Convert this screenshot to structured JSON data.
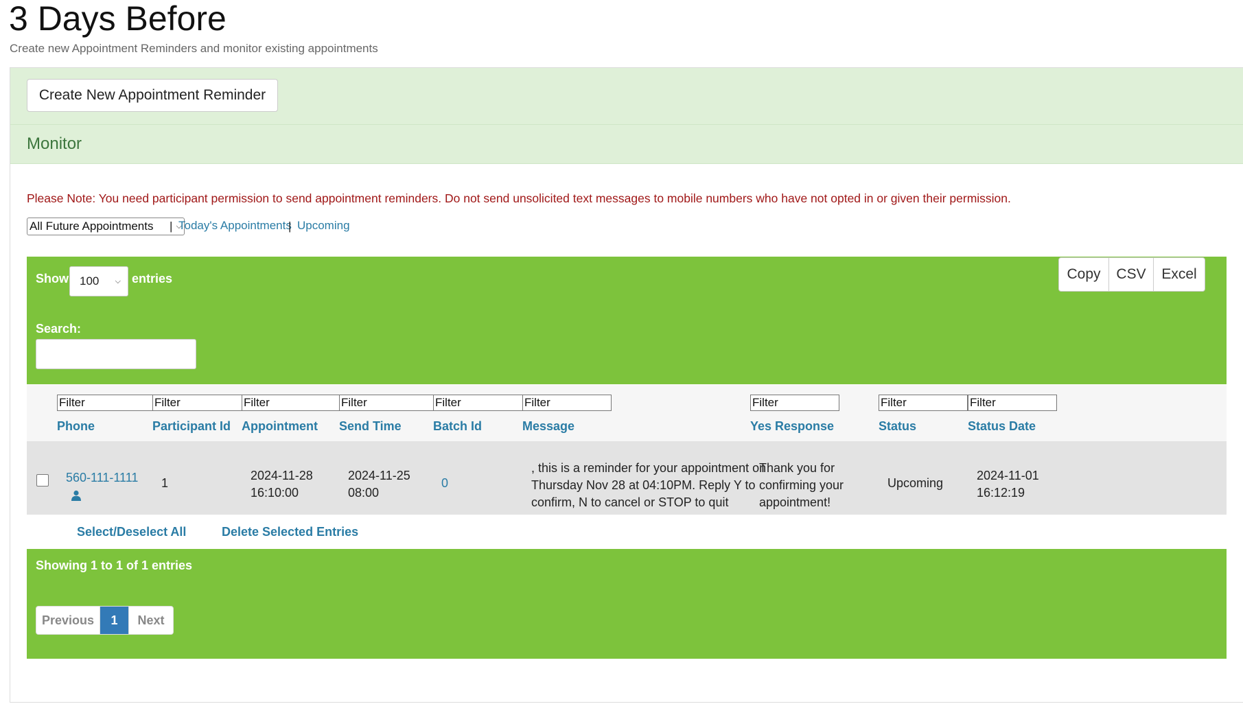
{
  "page": {
    "title": "3 Days Before",
    "subtitle": "Create new Appointment Reminders and monitor existing appointments"
  },
  "panel": {
    "create_button": "Create New Appointment Reminder",
    "heading": "Monitor",
    "notice": "Please Note: You need participant permission to send appointment reminders. Do not send unsolicited text messages to mobile numbers who have not opted in or given their permission."
  },
  "view_filter": {
    "selected": "All Future Appointments",
    "separator": "|",
    "links": [
      "Today's Appointments",
      "Upcoming"
    ]
  },
  "table_controls": {
    "show_label": "Show",
    "page_length": "100",
    "entries_label": "entries",
    "search_label": "Search:",
    "search_value": "",
    "export_buttons": [
      "Copy",
      "CSV",
      "Excel"
    ]
  },
  "table": {
    "filter_placeholder": "Filter",
    "columns": [
      "Phone",
      "Participant Id",
      "Appointment",
      "Send Time",
      "Batch Id",
      "Message",
      "Yes Response",
      "Status",
      "Status Date"
    ],
    "rows": [
      {
        "phone": "560-111-1111",
        "participant_id": "1",
        "appointment_date": "2024-11-28",
        "appointment_time": "16:10:00",
        "send_date": "2024-11-25",
        "send_time": "08:00",
        "batch_id": "0",
        "message_lines": [
          ", this is a reminder for your appointment on",
          "Thursday Nov 28 at 04:10PM. Reply Y to",
          "confirm, N to cancel or STOP to quit"
        ],
        "yes_response_lines": [
          "Thank you for",
          "confirming your",
          "appointment!"
        ],
        "status": "Upcoming",
        "status_date": "2024-11-01",
        "status_time": "16:12:19"
      }
    ]
  },
  "bulk_actions": {
    "select_all": "Select/Deselect All",
    "delete_selected": "Delete Selected Entries"
  },
  "footer": {
    "info": "Showing 1 to 1 of 1 entries",
    "previous": "Previous",
    "current_page": "1",
    "next": "Next"
  },
  "colors": {
    "accent_green": "#7dc33c",
    "panel_green": "#dff0d8",
    "link_blue": "#2a7ca5",
    "notice_red": "#a01818",
    "pager_active": "#337ab7"
  },
  "icons": {
    "participant": "person-icon",
    "dropdown": "chevron-down-icon"
  }
}
